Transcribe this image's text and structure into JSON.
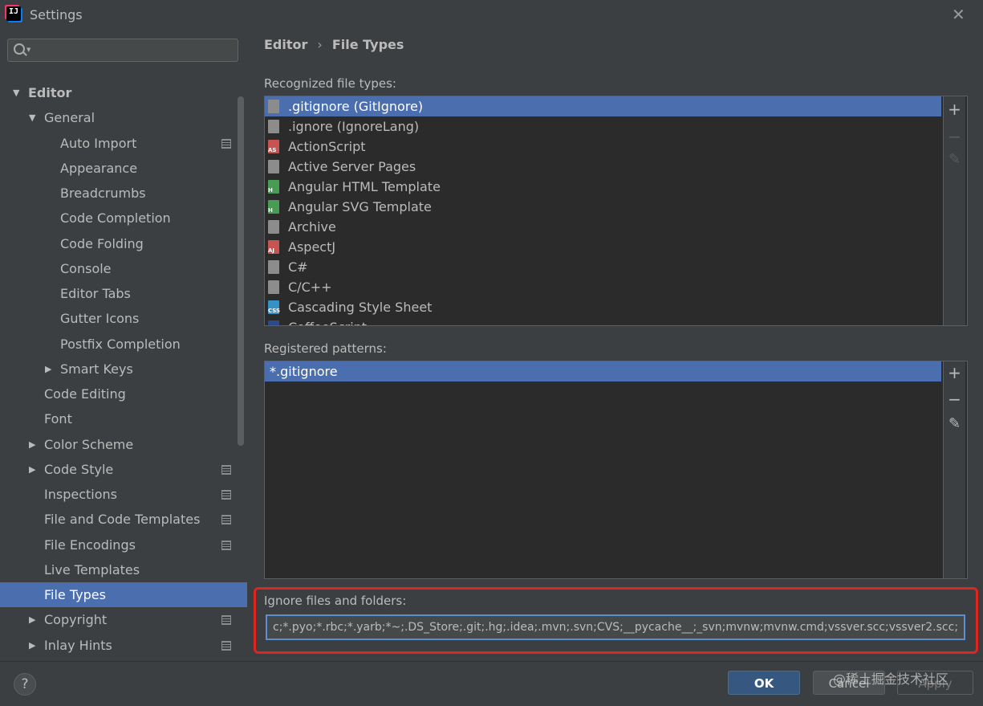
{
  "window": {
    "title": "Settings",
    "logo_text": "IJ"
  },
  "search": {
    "placeholder": ""
  },
  "tree": {
    "items": [
      {
        "label": "Editor",
        "level": 0,
        "expanded": true,
        "bold": true
      },
      {
        "label": "General",
        "level": 1,
        "expanded": true
      },
      {
        "label": "Auto Import",
        "level": 2,
        "project": true
      },
      {
        "label": "Appearance",
        "level": 2
      },
      {
        "label": "Breadcrumbs",
        "level": 2
      },
      {
        "label": "Code Completion",
        "level": 2
      },
      {
        "label": "Code Folding",
        "level": 2
      },
      {
        "label": "Console",
        "level": 2
      },
      {
        "label": "Editor Tabs",
        "level": 2
      },
      {
        "label": "Gutter Icons",
        "level": 2
      },
      {
        "label": "Postfix Completion",
        "level": 2
      },
      {
        "label": "Smart Keys",
        "level": 2,
        "collapsed": true
      },
      {
        "label": "Code Editing",
        "level": 1
      },
      {
        "label": "Font",
        "level": 1
      },
      {
        "label": "Color Scheme",
        "level": 1,
        "collapsed": true
      },
      {
        "label": "Code Style",
        "level": 1,
        "collapsed": true,
        "project": true
      },
      {
        "label": "Inspections",
        "level": 1,
        "project": true
      },
      {
        "label": "File and Code Templates",
        "level": 1,
        "project": true
      },
      {
        "label": "File Encodings",
        "level": 1,
        "project": true
      },
      {
        "label": "Live Templates",
        "level": 1
      },
      {
        "label": "File Types",
        "level": 1,
        "selected": true
      },
      {
        "label": "Copyright",
        "level": 1,
        "collapsed": true,
        "project": true
      },
      {
        "label": "Inlay Hints",
        "level": 1,
        "collapsed": true,
        "project": true
      }
    ]
  },
  "breadcrumb": {
    "parent": "Editor",
    "separator": "›",
    "current": "File Types"
  },
  "recognized": {
    "label": "Recognized file types:",
    "items": [
      {
        "name": ".gitignore (GitIgnore)",
        "icon": "gitignore-file-icon",
        "color": "#8c8c8c",
        "tag": "",
        "selected": true
      },
      {
        "name": ".ignore (IgnoreLang)",
        "icon": "ignore-file-icon",
        "color": "#8c8c8c",
        "tag": ""
      },
      {
        "name": "ActionScript",
        "icon": "actionscript-icon",
        "color": "#c75450",
        "tag": "AS"
      },
      {
        "name": "Active Server Pages",
        "icon": "asp-icon",
        "color": "#8c8c8c",
        "tag": ""
      },
      {
        "name": "Angular HTML Template",
        "icon": "angular-html-icon",
        "color": "#499c54",
        "tag": "H"
      },
      {
        "name": "Angular SVG Template",
        "icon": "angular-svg-icon",
        "color": "#499c54",
        "tag": "H"
      },
      {
        "name": "Archive",
        "icon": "archive-icon",
        "color": "#8c8c8c",
        "tag": ""
      },
      {
        "name": "AspectJ",
        "icon": "aspectj-icon",
        "color": "#c75450",
        "tag": "AJ"
      },
      {
        "name": "C#",
        "icon": "csharp-icon",
        "color": "#8c8c8c",
        "tag": ""
      },
      {
        "name": "C/C++",
        "icon": "c-cpp-icon",
        "color": "#8c8c8c",
        "tag": ""
      },
      {
        "name": "Cascading Style Sheet",
        "icon": "css-icon",
        "color": "#3592c4",
        "tag": "CSS"
      },
      {
        "name": "CoffeeScript",
        "icon": "coffeescript-icon",
        "color": "#2a4a8c",
        "tag": ""
      }
    ]
  },
  "patterns": {
    "label": "Registered patterns:",
    "items": [
      {
        "value": "*.gitignore",
        "selected": true
      }
    ]
  },
  "toolbar": {
    "add": "+",
    "remove": "−",
    "edit": "✎"
  },
  "ignore": {
    "label": "Ignore files and folders:",
    "value": "c;*.pyo;*.rbc;*.yarb;*~;.DS_Store;.git;.hg;.idea;.mvn;.svn;CVS;__pycache__;_svn;mvnw;mvnw.cmd;vssver.scc;vssver2.scc;"
  },
  "buttons": {
    "help": "?",
    "ok": "OK",
    "cancel": "Cancel",
    "apply": "Apply"
  },
  "watermark": "@稀土掘金技术社区"
}
